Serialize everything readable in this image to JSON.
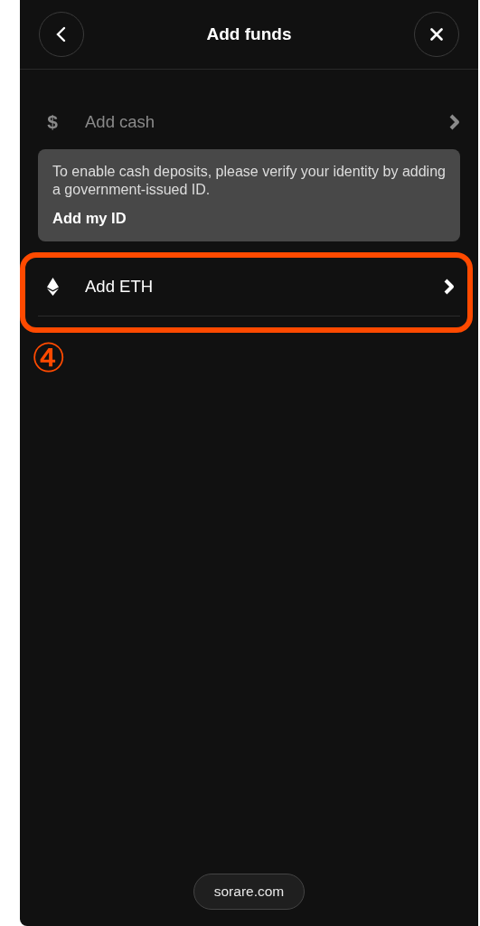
{
  "header": {
    "title": "Add funds"
  },
  "options": [
    {
      "kind": "cash",
      "symbol": "$",
      "label": "Add cash",
      "disabled": true,
      "highlighted": false,
      "notice": {
        "text": "To enable cash deposits, please verify your identity by adding a government-issued ID.",
        "link": "Add my ID"
      }
    },
    {
      "kind": "eth",
      "label": "Add ETH",
      "disabled": false,
      "highlighted": true
    }
  ],
  "annotation": "④",
  "footer": {
    "domain": "sorare.com"
  }
}
